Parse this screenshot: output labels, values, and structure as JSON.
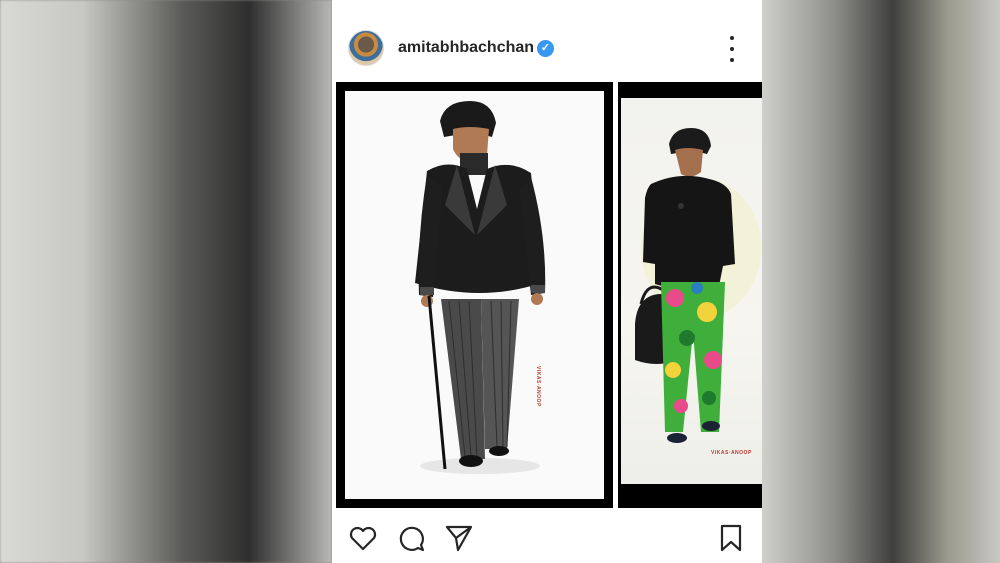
{
  "post": {
    "username": "amitabhbachchan",
    "verified": true,
    "more_options_icon": "more-vertical-icon"
  },
  "carousel": {
    "slides": [
      {
        "subject": "man in black velvet tuxedo jacket with striped trousers and cane",
        "brand_tag": "VIKAS·ANOOP"
      },
      {
        "subject": "man in black shirt and tropical print trousers holding a bag",
        "brand_tag": "VIKAS·ANOOP"
      }
    ]
  },
  "actions": {
    "like_icon": "heart-icon",
    "comment_icon": "comment-icon",
    "share_icon": "send-icon",
    "save_icon": "bookmark-icon"
  },
  "colors": {
    "verified_blue": "#3897f0",
    "text": "#262626"
  }
}
